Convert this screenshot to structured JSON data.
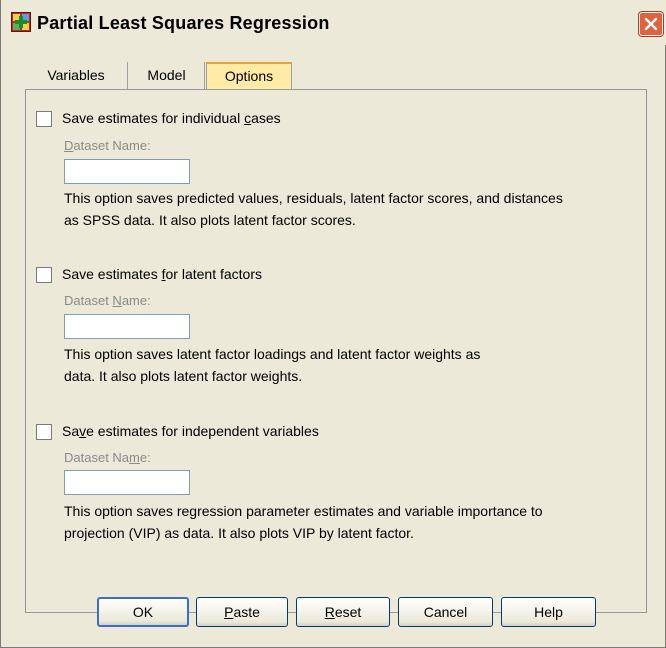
{
  "window": {
    "title": "Partial Least Squares Regression",
    "accent": "#e0623e"
  },
  "tabs": [
    {
      "label": "Variables",
      "active": false
    },
    {
      "label": "Model",
      "active": false
    },
    {
      "label": "Options",
      "active": true
    }
  ],
  "options": [
    {
      "checkbox_pre": "Save estimates for individual ",
      "checkbox_key": "c",
      "checkbox_post": "ases",
      "checked": false,
      "field_pre": "",
      "field_key": "D",
      "field_post": "ataset Name:",
      "value": "",
      "desc_line1": "This option saves predicted values, residuals, latent factor scores, and distances",
      "desc_line2": "as SPSS data. It also plots latent factor scores."
    },
    {
      "checkbox_pre": "Save estimates ",
      "checkbox_key": "f",
      "checkbox_post": "or latent factors",
      "checked": false,
      "field_pre": "Dataset ",
      "field_key": "N",
      "field_post": "ame:",
      "value": "",
      "desc_line1": "This option saves latent factor loadings and latent factor weights as",
      "desc_line2": "data. It also plots latent factor weights."
    },
    {
      "checkbox_pre": "Sa",
      "checkbox_key": "v",
      "checkbox_post": "e estimates for independent variables",
      "checked": false,
      "field_pre": "Dataset Na",
      "field_key": "m",
      "field_post": "e:",
      "value": "",
      "desc_line1": "This option saves regression parameter estimates and variable importance to",
      "desc_line2": "projection (VIP) as data. It also plots VIP by latent factor."
    }
  ],
  "buttons": {
    "ok": {
      "pre": "OK",
      "key": "",
      "post": ""
    },
    "paste": {
      "pre": "",
      "key": "P",
      "post": "aste"
    },
    "reset": {
      "pre": "",
      "key": "R",
      "post": "eset"
    },
    "cancel": {
      "pre": "Cancel",
      "key": "",
      "post": ""
    },
    "help": {
      "pre": "Help",
      "key": "",
      "post": ""
    }
  }
}
